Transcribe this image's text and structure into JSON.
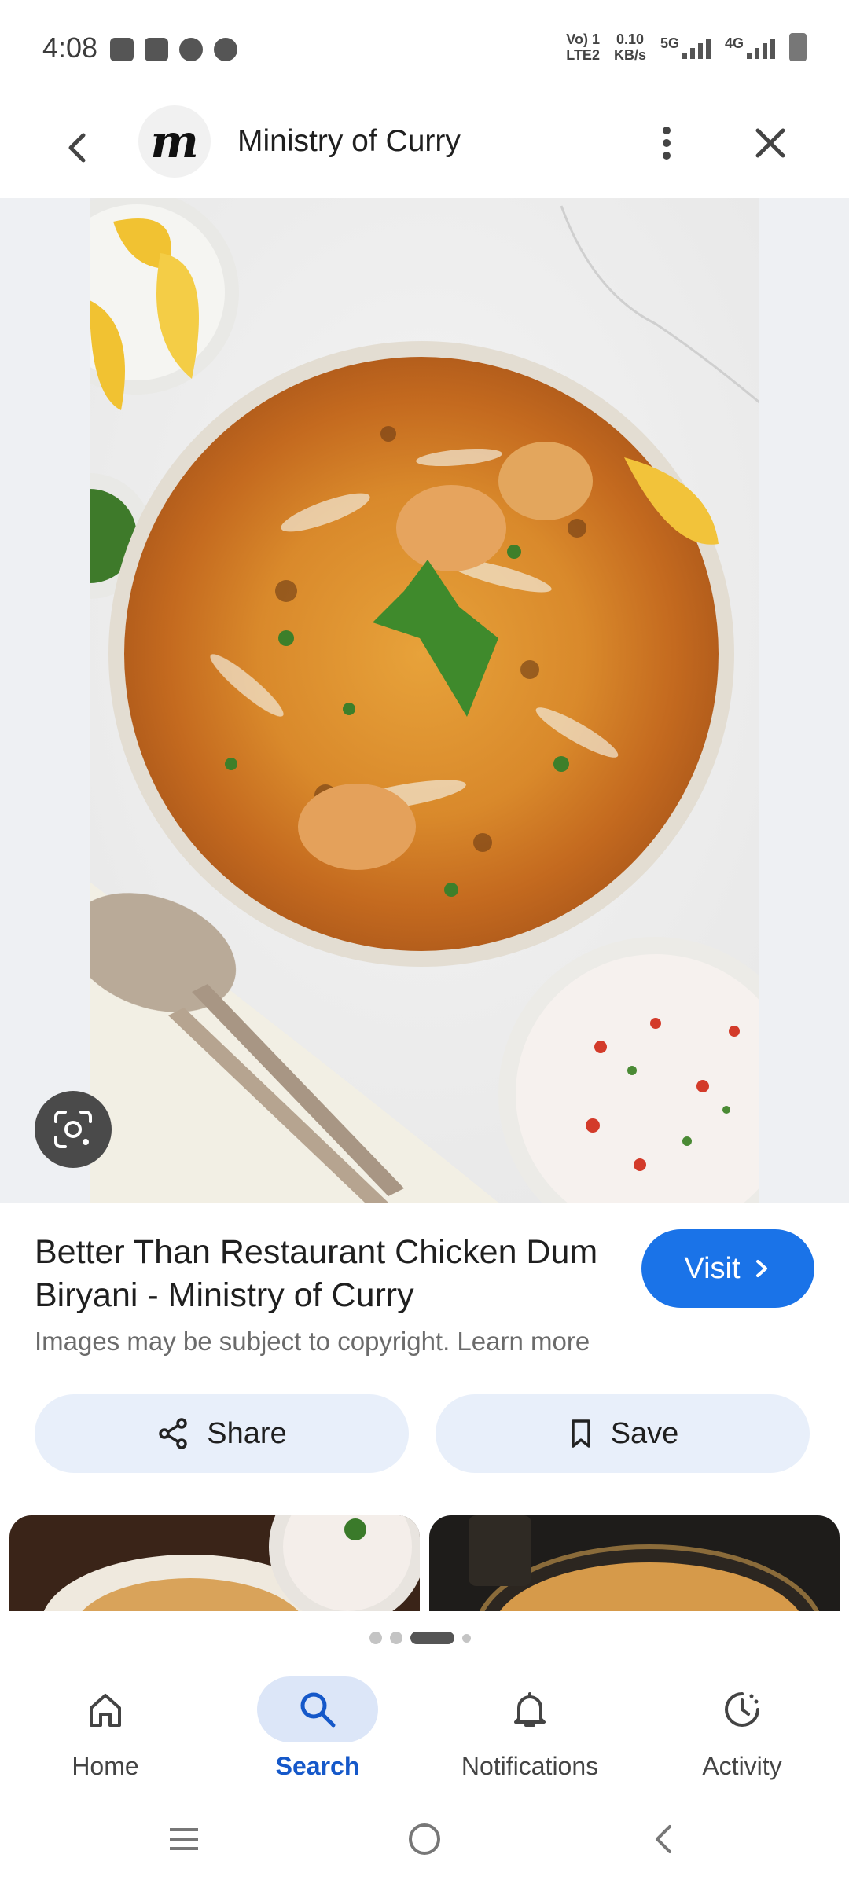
{
  "status_bar": {
    "time": "4:08",
    "network_line1": "Vo) 1",
    "network_line2": "LTE2",
    "speed_line1": "0.10",
    "speed_line2": "KB/s",
    "sim1": "5G",
    "sim2": "4G"
  },
  "header": {
    "avatar_letter": "m",
    "site_name": "Ministry of Curry"
  },
  "result": {
    "title": "Better Than Restaurant Chicken Dum Biryani - Ministry of Curry",
    "visit_label": "Visit",
    "copyright": "Images may be subject to copyright. Learn more",
    "share_label": "Share",
    "save_label": "Save"
  },
  "bottom_nav": {
    "items": [
      {
        "label": "Home",
        "icon": "home-icon"
      },
      {
        "label": "Search",
        "icon": "search-icon",
        "active": true
      },
      {
        "label": "Notifications",
        "icon": "bell-icon"
      },
      {
        "label": "Activity",
        "icon": "activity-icon"
      }
    ]
  },
  "colors": {
    "accent": "#1a73e8",
    "active_nav": "#1558c9",
    "pill_bg": "#e8effa"
  }
}
